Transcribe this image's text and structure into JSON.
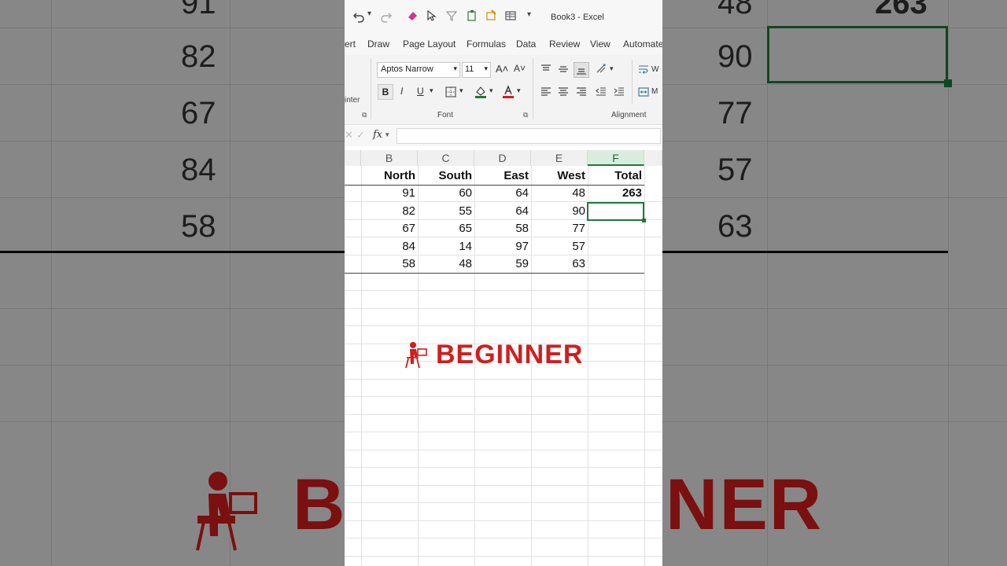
{
  "window": {
    "title": "Book3 - Excel"
  },
  "tabs": [
    "ert",
    "Draw",
    "Page Layout",
    "Formulas",
    "Data",
    "Review",
    "View",
    "Automate"
  ],
  "ribbon": {
    "font_name": "Aptos Narrow",
    "font_size": "11",
    "grow_font": "A˄",
    "shrink_font": "A˅",
    "bold": "B",
    "italic": "I",
    "underline": "U",
    "painter_label": "inter",
    "group_font": "Font",
    "group_alignment": "Alignment",
    "wrap_text": "W",
    "merge": "M"
  },
  "formula_bar": {
    "fx": "fx",
    "value": ""
  },
  "columns": [
    "B",
    "C",
    "D",
    "E",
    "F"
  ],
  "active_column": "F",
  "table": {
    "headers": [
      "North",
      "South",
      "East",
      "West",
      "Total"
    ],
    "rows": [
      [
        "91",
        "60",
        "64",
        "48",
        "263"
      ],
      [
        "82",
        "55",
        "64",
        "90",
        ""
      ],
      [
        "67",
        "65",
        "58",
        "77",
        ""
      ],
      [
        "84",
        "14",
        "97",
        "57",
        ""
      ],
      [
        "58",
        "48",
        "59",
        "63",
        ""
      ]
    ]
  },
  "badge": {
    "label": "BEGINNER",
    "color": "#d21d1d"
  },
  "background": {
    "col_a": [
      "91",
      "82",
      "67",
      "84",
      "58"
    ],
    "col_b": [
      "48",
      "90",
      "77",
      "57",
      "63"
    ],
    "total": "263",
    "big_text_left": "B",
    "big_text_right": "NER"
  },
  "colors": {
    "accent": "#1e7a3a",
    "badge_red": "#d21d1d"
  }
}
